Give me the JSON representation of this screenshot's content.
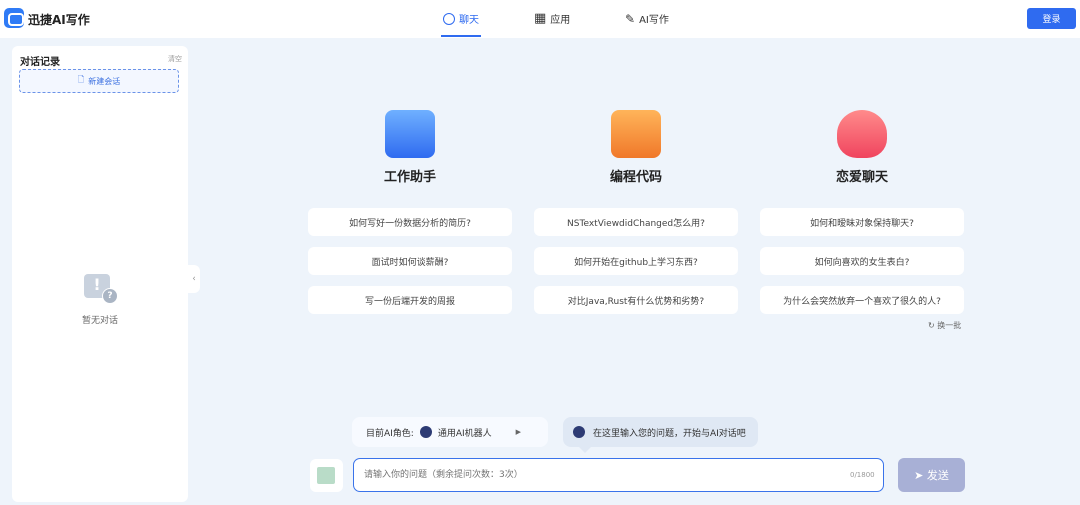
{
  "header": {
    "brand": "迅捷AI写作",
    "nav": [
      {
        "label": "聊天",
        "icon": "chat-icon"
      },
      {
        "label": "应用",
        "icon": "grid-icon"
      },
      {
        "label": "AI写作",
        "icon": "pen-icon"
      }
    ],
    "login": "登录"
  },
  "sidebar": {
    "title": "对话记录",
    "clear": "清空",
    "new_chat": "新建会话",
    "empty": "暂无对话"
  },
  "categories": [
    {
      "title": "工作助手",
      "icon": "monitor-chart-icon",
      "color": "#3a7cf0",
      "questions": [
        "如何写好一份数据分析的简历?",
        "面试时如何谈薪酬?",
        "写一份后端开发的周报"
      ]
    },
    {
      "title": "编程代码",
      "icon": "code-file-icon",
      "color": "#f28a2e",
      "questions": [
        "NSTextViewdidChanged怎么用?",
        "如何开始在github上学习东西?",
        "对比Java,Rust有什么优势和劣势?"
      ]
    },
    {
      "title": "恋爱聊天",
      "icon": "heart-chat-icon",
      "color": "#f4556a",
      "questions": [
        "如何和暧昧对象保持聊天?",
        "如何向喜欢的女生表白?",
        "为什么会突然放弃一个喜欢了很久的人?"
      ]
    }
  ],
  "refresh": "换一批",
  "role": {
    "label": "目前AI角色:",
    "name": "通用AI机器人"
  },
  "tip": "在这里输入您的问题，开始与AI对话吧",
  "input": {
    "placeholder": "请输入你的问题（剩余提问次数：3次）",
    "value": "",
    "count": "0/1800"
  },
  "send": "发送",
  "colors": {
    "accent": "#2f6bf0",
    "send_disabled": "#a8b0d6"
  }
}
